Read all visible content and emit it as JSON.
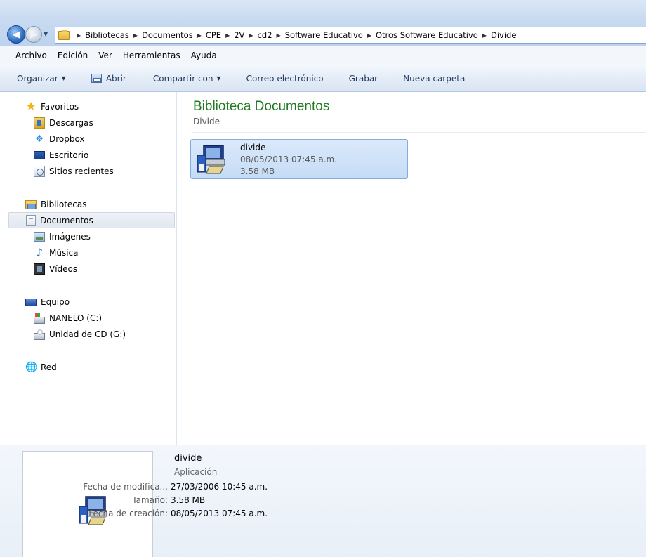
{
  "address": {
    "crumbs": [
      "Bibliotecas",
      "Documentos",
      "CPE",
      "2V",
      "cd2",
      "Software Educativo",
      "Otros Software Educativo",
      "Divide"
    ]
  },
  "menu": {
    "archivo": "Archivo",
    "edicion": "Edición",
    "ver": "Ver",
    "herramientas": "Herramientas",
    "ayuda": "Ayuda"
  },
  "toolbar": {
    "organizar": "Organizar",
    "abrir": "Abrir",
    "compartir": "Compartir con",
    "correo": "Correo electrónico",
    "grabar": "Grabar",
    "nueva_carpeta": "Nueva carpeta"
  },
  "sidebar": {
    "favoritos": "Favoritos",
    "descargas": "Descargas",
    "dropbox": "Dropbox",
    "escritorio": "Escritorio",
    "sitios_recientes": "Sitios recientes",
    "bibliotecas": "Bibliotecas",
    "documentos": "Documentos",
    "imagenes": "Imágenes",
    "musica": "Música",
    "videos": "Vídeos",
    "equipo": "Equipo",
    "nanelo": "NANELO (C:)",
    "cd": "Unidad de CD (G:)",
    "red": "Red"
  },
  "main": {
    "title": "Biblioteca Documentos",
    "subtitle": "Divide",
    "file": {
      "name": "divide",
      "date": "08/05/2013 07:45 a.m.",
      "size": "3.58 MB"
    }
  },
  "details": {
    "name": "divide",
    "type": "Aplicación",
    "modified_label": "Fecha de modifica...",
    "modified_value": "27/03/2006 10:45 a.m.",
    "size_label": "Tamaño:",
    "size_value": "3.58 MB",
    "created_label": "Fecha de creación:",
    "created_value": "08/05/2013 07:45 a.m."
  }
}
